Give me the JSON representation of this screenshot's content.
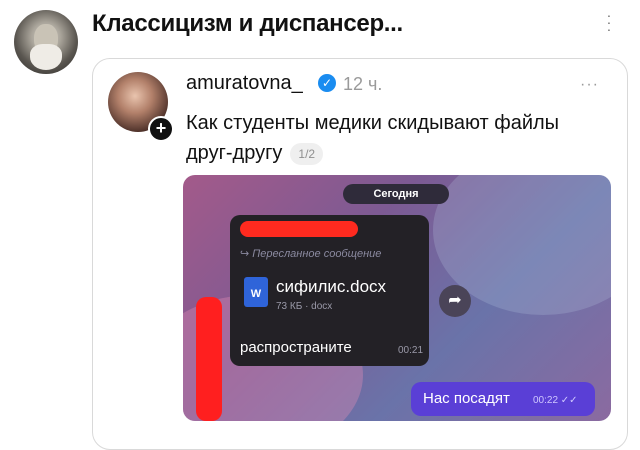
{
  "header": {
    "title": "Классицизм и диспансер..."
  },
  "post": {
    "author": "amuratovna_",
    "time": "12 ч.",
    "text": "Как студенты медики скидывают файлы друг-другу",
    "pager": "1/2",
    "more": "···",
    "add_glyph": "+",
    "verified_glyph": "✓"
  },
  "screenshot": {
    "date_pill": "Сегодня",
    "forwarded_label": "Пересланное сообщение",
    "file": {
      "icon_letter": "W",
      "name": "сифилис.docx",
      "meta": "73 КБ · docx"
    },
    "incoming_text": "распространите",
    "incoming_time": "00:21",
    "outgoing_text": "Нас посадят",
    "outgoing_time": "00:22 ✓✓",
    "share_glyph": "➦"
  },
  "colors": {
    "verified": "#1a8cf0",
    "outgoing_bubble": "#5a3fd6",
    "incoming_bubble": "#232126",
    "redaction": "#ff2a1f",
    "word_file": "#2f64d9"
  }
}
